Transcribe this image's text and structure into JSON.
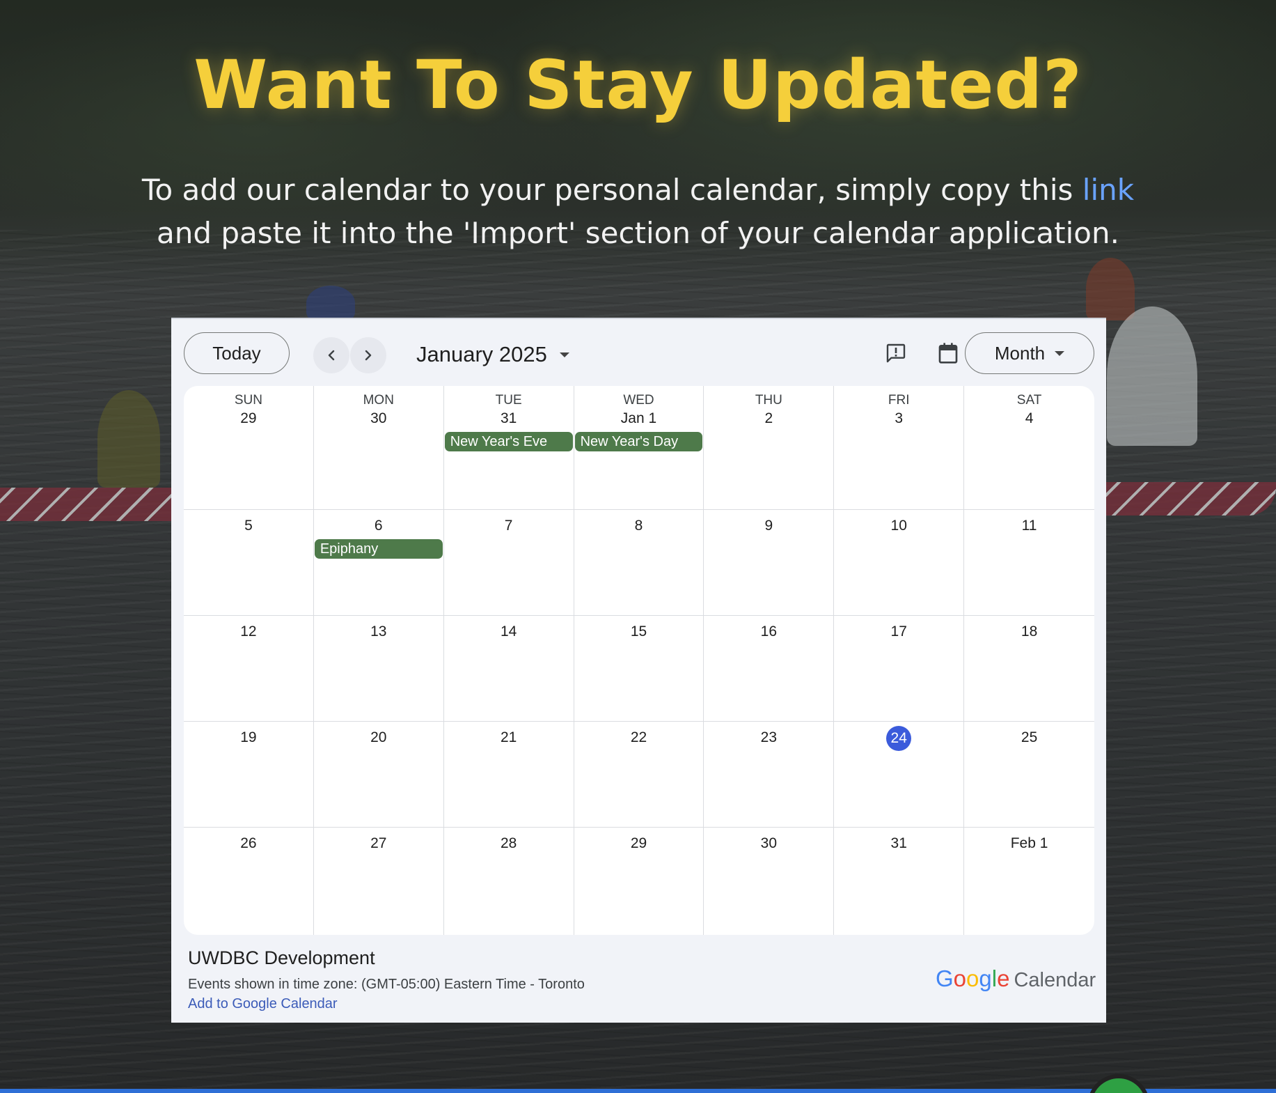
{
  "page": {
    "heading": "Want To Stay Updated?",
    "subtitle_before": "To add our calendar to your personal calendar, simply copy this ",
    "subtitle_link": "link",
    "subtitle_after": " and paste it into the 'Import' section of your calendar application."
  },
  "calendar": {
    "today_label": "Today",
    "month_label": "January 2025",
    "view_label": "Month",
    "weekdays": [
      "SUN",
      "MON",
      "TUE",
      "WED",
      "THU",
      "FRI",
      "SAT"
    ],
    "weeks": [
      [
        {
          "day": "29",
          "events": []
        },
        {
          "day": "30",
          "events": []
        },
        {
          "day": "31",
          "events": [
            "New Year's Eve"
          ]
        },
        {
          "day": "Jan 1",
          "events": [
            "New Year's Day"
          ]
        },
        {
          "day": "2",
          "events": []
        },
        {
          "day": "3",
          "events": []
        },
        {
          "day": "4",
          "events": []
        }
      ],
      [
        {
          "day": "5",
          "events": []
        },
        {
          "day": "6",
          "events": [
            "Epiphany"
          ]
        },
        {
          "day": "7",
          "events": []
        },
        {
          "day": "8",
          "events": []
        },
        {
          "day": "9",
          "events": []
        },
        {
          "day": "10",
          "events": []
        },
        {
          "day": "11",
          "events": []
        }
      ],
      [
        {
          "day": "12",
          "events": []
        },
        {
          "day": "13",
          "events": []
        },
        {
          "day": "14",
          "events": []
        },
        {
          "day": "15",
          "events": []
        },
        {
          "day": "16",
          "events": []
        },
        {
          "day": "17",
          "events": []
        },
        {
          "day": "18",
          "events": []
        }
      ],
      [
        {
          "day": "19",
          "events": []
        },
        {
          "day": "20",
          "events": []
        },
        {
          "day": "21",
          "events": []
        },
        {
          "day": "22",
          "events": []
        },
        {
          "day": "23",
          "events": []
        },
        {
          "day": "24",
          "events": [],
          "today": true
        },
        {
          "day": "25",
          "events": []
        }
      ],
      [
        {
          "day": "26",
          "events": []
        },
        {
          "day": "27",
          "events": []
        },
        {
          "day": "28",
          "events": []
        },
        {
          "day": "29",
          "events": []
        },
        {
          "day": "30",
          "events": []
        },
        {
          "day": "31",
          "events": []
        },
        {
          "day": "Feb 1",
          "events": []
        }
      ]
    ],
    "footer": {
      "title": "UWDBC Development",
      "timezone": "Events shown in time zone: (GMT-05:00) Eastern Time - Toronto",
      "add_link": "Add to Google Calendar",
      "brand_google": "Google",
      "brand_word": "Calendar"
    },
    "icons": {
      "prev": "chevron-left-icon",
      "next": "chevron-right-icon",
      "feedback": "feedback-icon",
      "calendar": "calendar-icon",
      "dropdown": "caret-down-icon"
    }
  },
  "colors": {
    "heading": "#f5cf3b",
    "link": "#6aa3ff",
    "event": "#4e7a4a",
    "today": "#3b5bdb"
  }
}
